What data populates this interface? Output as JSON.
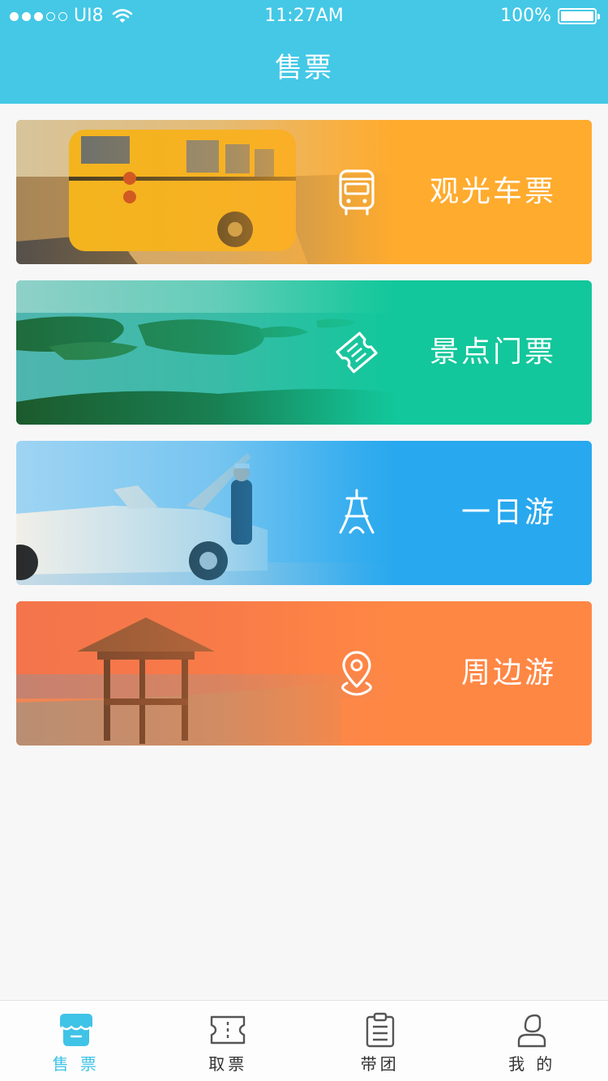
{
  "status_bar": {
    "signal_dots": [
      true,
      true,
      true,
      false,
      false
    ],
    "carrier": "UI8",
    "time": "11:27AM",
    "battery": "100%",
    "battery_level": 1.0
  },
  "nav": {
    "title": "售票"
  },
  "cards": [
    {
      "label": "观光车票",
      "icon": "bus-icon",
      "color": "#ffab2e"
    },
    {
      "label": "景点门票",
      "icon": "ticket-icon",
      "color": "#12c79b"
    },
    {
      "label": "一日游",
      "icon": "tower-icon",
      "color": "#28a8ee"
    },
    {
      "label": "周边游",
      "icon": "location-pin-icon",
      "color": "#ff8744"
    }
  ],
  "tabbar": {
    "items": [
      {
        "label": "售 票",
        "icon": "shop-icon",
        "active": true
      },
      {
        "label": "取票",
        "icon": "ticket-stub-icon",
        "active": false
      },
      {
        "label": "带团",
        "icon": "clipboard-icon",
        "active": false
      },
      {
        "label": "我 的",
        "icon": "user-icon",
        "active": false
      }
    ],
    "active_color": "#3fc3e6"
  },
  "colors": {
    "header": "#44c8e6",
    "background": "#f7f7f7"
  }
}
